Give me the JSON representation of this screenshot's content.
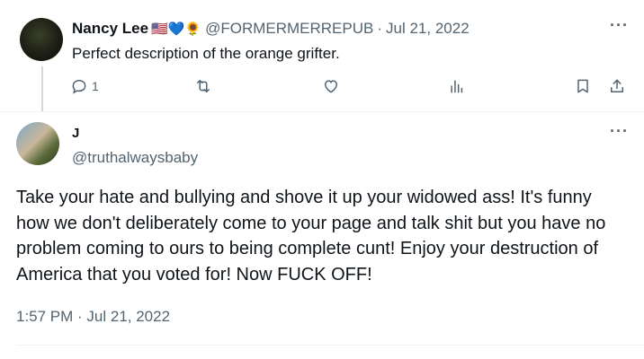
{
  "reply": {
    "name": "Nancy Lee",
    "emojis": "🇺🇸💙🌻",
    "handle": "@FORMERMERREPUB",
    "separator": "·",
    "date": "Jul 21, 2022",
    "text": "Perfect description of the orange grifter.",
    "reply_count": "1",
    "more": "···"
  },
  "main": {
    "name": "J",
    "handle": "@truthalwaysbaby",
    "text": "Take your hate and bullying and shove it up your widowed ass! It's funny how we don't deliberately come to your page and talk shit but you have no problem coming to ours to being complete cunt! Enjoy your destruction of America that you voted for! Now FUCK OFF!",
    "timestamp": "1:57 PM · Jul 21, 2022",
    "more": "···"
  },
  "icons": {
    "reply": "reply-icon",
    "retweet": "retweet-icon",
    "like": "heart-icon",
    "views": "views-icon",
    "bookmark": "bookmark-icon",
    "share": "share-icon",
    "more": "more-icon"
  },
  "colors": {
    "text": "#0f1419",
    "secondary": "#536471",
    "divider": "#eff3f4"
  }
}
